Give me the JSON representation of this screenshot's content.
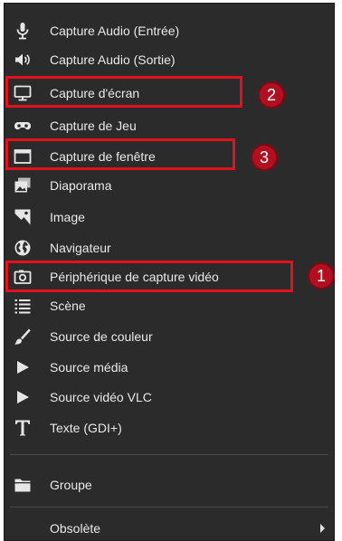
{
  "menu": {
    "items": [
      {
        "label": "Capture Audio (Entrée)",
        "icon": "microphone-icon"
      },
      {
        "label": "Capture Audio (Sortie)",
        "icon": "speaker-icon"
      },
      {
        "label": "Capture d'écran",
        "icon": "monitor-icon"
      },
      {
        "label": "Capture de Jeu",
        "icon": "gamepad-icon"
      },
      {
        "label": "Capture de fenêtre",
        "icon": "window-icon"
      },
      {
        "label": "Diaporama",
        "icon": "slideshow-icon"
      },
      {
        "label": "Image",
        "icon": "image-icon"
      },
      {
        "label": "Navigateur",
        "icon": "globe-icon"
      },
      {
        "label": "Périphérique de capture vidéo",
        "icon": "camera-icon"
      },
      {
        "label": "Scène",
        "icon": "list-icon"
      },
      {
        "label": "Source de couleur",
        "icon": "brush-icon"
      },
      {
        "label": "Source média",
        "icon": "play-icon"
      },
      {
        "label": "Source vidéo VLC",
        "icon": "play-icon"
      },
      {
        "label": "Texte (GDI+)",
        "icon": "text-icon"
      }
    ],
    "group_label": "Groupe",
    "deprecated_label": "Obsolète"
  },
  "annotations": {
    "badges": [
      "1",
      "2",
      "3"
    ],
    "highlight_color": "#e3101e",
    "badge_color": "#b01020"
  }
}
